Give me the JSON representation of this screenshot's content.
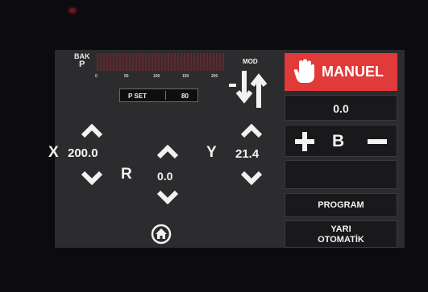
{
  "meter": {
    "label_top": "BAK",
    "label_bottom": "P",
    "scale": [
      "0",
      "50",
      "100",
      "150",
      "200"
    ]
  },
  "pset": {
    "label": "P SET",
    "value": "80"
  },
  "mode": {
    "label": "MOD"
  },
  "axes": {
    "x": {
      "name": "X",
      "value": "200.0"
    },
    "r": {
      "name": "R",
      "value": "0.0"
    },
    "y": {
      "name": "Y",
      "value": "21.4"
    }
  },
  "panel": {
    "mode_button": "MANUEL",
    "value_display": "0.0",
    "b_label": "B",
    "program_button": "PROGRAM",
    "semi_auto_line1": "YARI",
    "semi_auto_line2": "OTOMATİK"
  },
  "colors": {
    "accent_red": "#e03a3a",
    "screen_bg": "#2c2c2e",
    "panel_bg": "#19191b"
  },
  "icons": [
    "hand-icon",
    "updown-arrows-icon",
    "home-icon",
    "chevron-up-icon",
    "chevron-down-icon",
    "plus-icon",
    "minus-icon"
  ]
}
